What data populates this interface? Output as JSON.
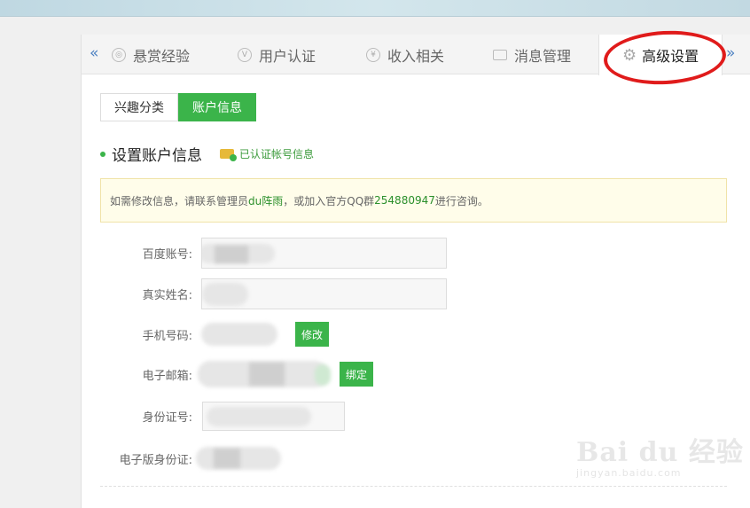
{
  "tabs": [
    {
      "label": "悬赏经验",
      "icon": "coin-icon"
    },
    {
      "label": "用户认证",
      "icon": "verified-v-icon"
    },
    {
      "label": "收入相关",
      "icon": "yen-icon"
    },
    {
      "label": "消息管理",
      "icon": "envelope-icon"
    },
    {
      "label": "高级设置",
      "icon": "gear-icon",
      "active": true
    }
  ],
  "arrows": {
    "left": "«",
    "right": "»"
  },
  "subtabs": [
    {
      "label": "兴趣分类"
    },
    {
      "label": "账户信息",
      "active": true
    }
  ],
  "section": {
    "title": "设置账户信息",
    "verified": "已认证帐号信息"
  },
  "notice": {
    "prefix": "如需修改信息，请联系管理员",
    "admin": "du阵雨",
    "middle": "，或加入官方QQ群",
    "qq": "254880947",
    "suffix": "进行咨询。"
  },
  "fields": {
    "baidu_account": "百度账号:",
    "real_name": "真实姓名:",
    "phone": "手机号码:",
    "email": "电子邮箱:",
    "id_number": "身份证号:",
    "e_id": "电子版身份证:"
  },
  "buttons": {
    "modify": "修改",
    "bind": "绑定"
  },
  "watermark": {
    "brand": "Bai du 经验",
    "url": "jingyan.baidu.com"
  },
  "colors": {
    "accent": "#3bb44a",
    "highlight": "#e01b1b"
  }
}
